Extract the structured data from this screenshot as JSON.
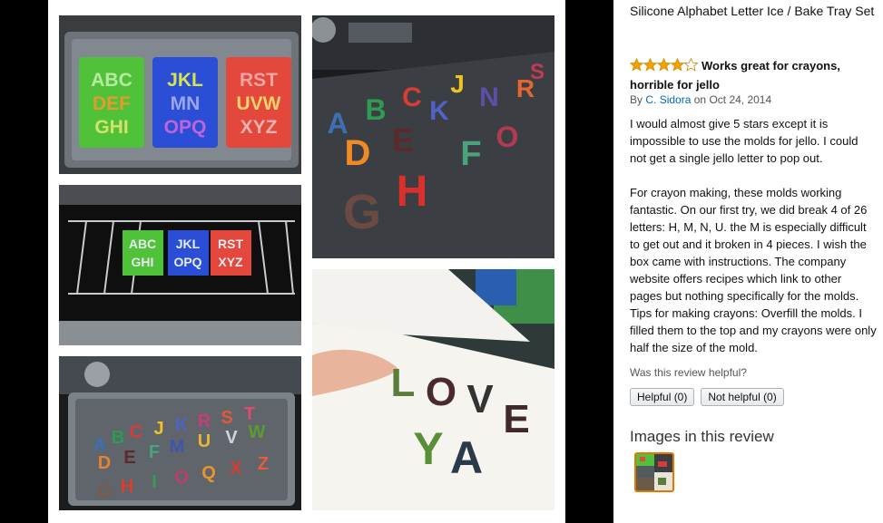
{
  "product": {
    "title": "Silicone Alphabet Letter Ice / Bake Tray Set"
  },
  "review": {
    "rating": 4,
    "max_rating": 5,
    "headline": "Works great for crayons, horrible for jello",
    "by_prefix": "By",
    "author": "C. Sidora",
    "date_prefix": "on",
    "date": "Oct 24, 2014",
    "paragraphs": [
      "I would almost give 5 stars except it is impossible to use the molds for jello. I could not get a single jello letter to pop out.",
      "For crayon making, these molds working fantastic. On our first try, we did break 4 of 26 letters: H, M, N, U. the M is especially difficult to get out and it broken in 4 pieces. I wish the box came with instructions. The company website offers recipes which link to other pages but nothing specifically for the molds. Tips for making crayons: Overfill the molds. I filled them to the top and my crayons were only half the size of the mold."
    ],
    "helpful_question": "Was this review helpful?",
    "helpful_button": "Helpful (0)",
    "not_helpful_button": "Not helpful (0)"
  },
  "images_section": {
    "heading": "Images in this review"
  },
  "photos": {
    "tray_molds": {
      "mold1": "ABC DEF GHI",
      "mold2": "JKL MN OPQ",
      "mold3": "RST UVW XYZ"
    },
    "note_letters": "LOVE YA"
  },
  "colors": {
    "link": "#0066c0",
    "star": "#f0a000",
    "thumb_border": "#e77600",
    "mold_green": "#4fc23a",
    "mold_blue": "#2a4fd6",
    "mold_red": "#e4473c"
  }
}
